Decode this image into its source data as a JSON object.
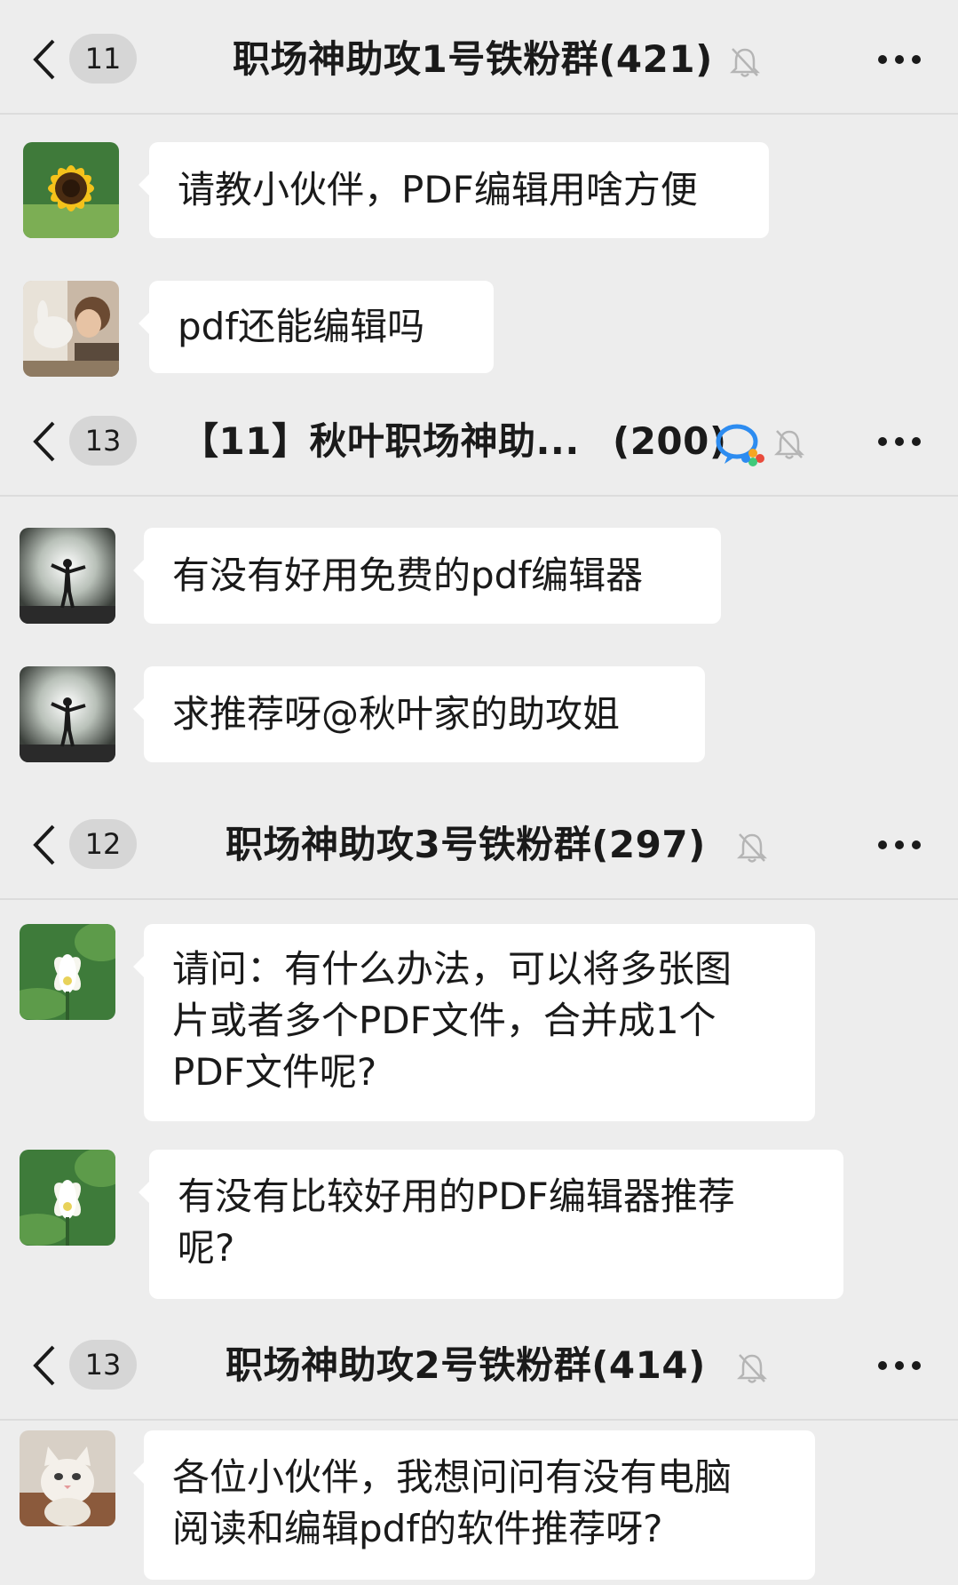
{
  "groups": [
    {
      "unread_count": "11",
      "title": "职场神助攻1号铁粉群(421)",
      "messages": [
        {
          "avatar": "sunflower-avatar",
          "lines": [
            "请教小伙伴，PDF编辑用啥方便"
          ]
        },
        {
          "avatar": "girl-rabbit-avatar",
          "lines": [
            "pdf还能编辑吗"
          ]
        }
      ]
    },
    {
      "unread_count": "13",
      "title": "【11】秋叶职场神助...",
      "member_count": "(200)",
      "messages": [
        {
          "avatar": "silhouette-avatar",
          "lines": [
            "有没有好用免费的pdf编辑器"
          ]
        },
        {
          "avatar": "silhouette-avatar",
          "lines": [
            "求推荐呀@秋叶家的助攻姐"
          ]
        }
      ]
    },
    {
      "unread_count": "12",
      "title": "职场神助攻3号铁粉群(297)",
      "messages": [
        {
          "avatar": "lotus-avatar",
          "lines": [
            "请问：有什么办法，可以将多张图",
            "片或者多个PDF文件，合并成1个",
            "PDF文件呢?"
          ]
        },
        {
          "avatar": "lotus-avatar",
          "lines": [
            "有没有比较好用的PDF编辑器推荐",
            "呢?"
          ]
        }
      ]
    },
    {
      "unread_count": "13",
      "title": "职场神助攻2号铁粉群(414)",
      "messages": [
        {
          "avatar": "cat-avatar",
          "lines": [
            "各位小伙伴，我想问问有没有电脑",
            "阅读和编辑pdf的软件推荐呀?"
          ]
        }
      ]
    }
  ],
  "colors": {
    "background": "#ededed",
    "bubble": "#ffffff",
    "badge": "#d6d6d6"
  }
}
